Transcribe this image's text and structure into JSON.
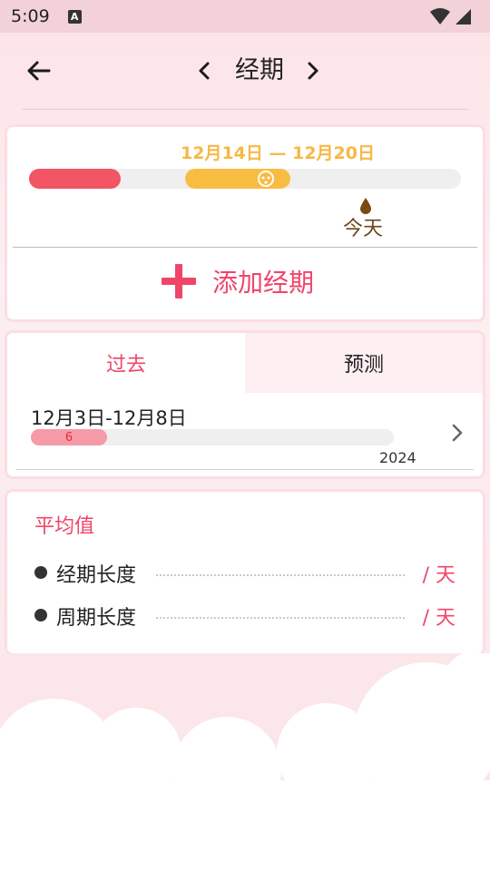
{
  "status_bar": {
    "time": "5:09",
    "notification_icon": "A"
  },
  "header": {
    "title": "经期",
    "back_icon": "arrow-left-icon",
    "prev_icon": "chevron-left-icon",
    "next_icon": "chevron-right-icon"
  },
  "current_period": {
    "range_label": "12月14日 — 12月20日",
    "today_label": "今天",
    "add_label": "添加经期",
    "colors": {
      "past_segment": "#f25563",
      "current_segment": "#f9bc43",
      "accent": "#f0456a"
    }
  },
  "history": {
    "tabs": [
      {
        "label": "过去",
        "active": true
      },
      {
        "label": "预测",
        "active": false
      }
    ],
    "entries": [
      {
        "range": "12月3日-12月8日",
        "days": "6",
        "year": "2024"
      }
    ]
  },
  "averages": {
    "title": "平均值",
    "rows": [
      {
        "label": "经期长度",
        "value": "/ 天"
      },
      {
        "label": "周期长度",
        "value": "/ 天"
      }
    ]
  }
}
